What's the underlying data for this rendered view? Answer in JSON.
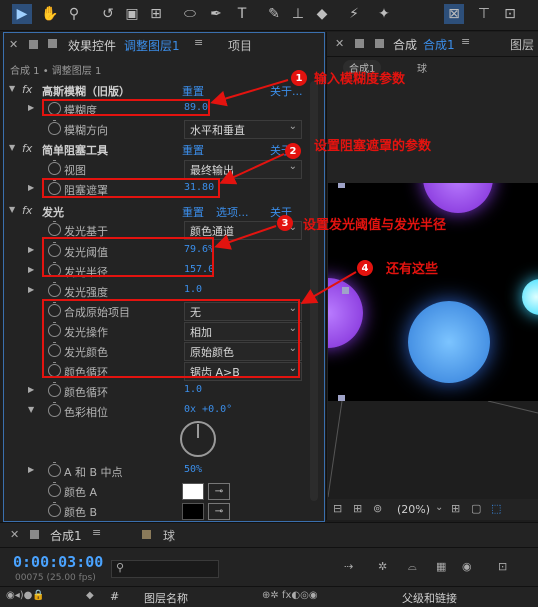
{
  "toolbar": {
    "icons": [
      "selection-tool",
      "hand-tool",
      "zoom-tool",
      "rotate-tool",
      "camera-tool",
      "pan-behind-tool",
      "ellipse-tool",
      "pen-tool",
      "type-tool",
      "brush-tool",
      "clone-stamp-tool",
      "eraser-tool",
      "roto-brush-tool",
      "puppet-tool"
    ]
  },
  "left_panel": {
    "tab_label": "效果控件",
    "tab_layer": "调整图层1",
    "tab_project": "项目",
    "breadcrumb": "合成 1 • 调整图层 1",
    "effects": [
      {
        "name": "高斯模糊（旧版）",
        "reset": "重置",
        "about": "关于..."
      },
      {
        "name": "简单阻塞工具",
        "reset": "重置",
        "about": "关于"
      },
      {
        "name": "发光",
        "reset": "重置",
        "options": "选项...",
        "about": "关于"
      }
    ],
    "params": {
      "blurriness": {
        "label": "模糊度",
        "value": "89.0"
      },
      "blur_dimensions": {
        "label": "模糊方向",
        "value": "水平和垂直"
      },
      "view": {
        "label": "视图",
        "value": "最终输出"
      },
      "choke_matte": {
        "label": "阻塞遮罩",
        "value": "31.80"
      },
      "glow_based_on": {
        "label": "发光基于",
        "value": "颜色通道"
      },
      "glow_threshold": {
        "label": "发光阈值",
        "value": "79.6%"
      },
      "glow_radius": {
        "label": "发光半径",
        "value": "157.0"
      },
      "glow_intensity": {
        "label": "发光强度",
        "value": "1.0"
      },
      "composite_original": {
        "label": "合成原始项目",
        "value": "无"
      },
      "glow_operation": {
        "label": "发光操作",
        "value": "相加"
      },
      "glow_colors": {
        "label": "发光颜色",
        "value": "原始颜色"
      },
      "color_looping": {
        "label": "颜色循环",
        "value": "锯齿 A>B"
      },
      "color_loops": {
        "label": "颜色循环",
        "value": "1.0"
      },
      "color_phase": {
        "label": "色彩相位",
        "value": "0x +0.0°"
      },
      "ab_midpoint": {
        "label": "A 和 B 中点",
        "value": "50%"
      },
      "color_a": {
        "label": "颜色 A"
      },
      "color_b": {
        "label": "颜色 B"
      }
    }
  },
  "annotations": [
    {
      "num": "1",
      "text": "输入模糊度参数"
    },
    {
      "num": "2",
      "text": "设置阻塞遮罩的参数"
    },
    {
      "num": "3",
      "text": "设置发光阈值与发光半径"
    },
    {
      "num": "4",
      "text": "还有这些"
    }
  ],
  "right_panel": {
    "tab_prefix": "合成",
    "tab_comp": "合成1",
    "tab_layer": "图层",
    "sub_tab": "合成1",
    "sub_tab2": "球",
    "zoom": "(20%)"
  },
  "timeline": {
    "tab_comp": "合成1",
    "tab_ball": "球",
    "timecode": "0:00:03:00",
    "frames": "00075 (25.00 fps)",
    "search_placeholder": "",
    "col_hash": "#",
    "col_layer_name": "图层名称",
    "col_parent": "父级和链接"
  },
  "colors": {
    "accent": "#3b8eea",
    "annotation": "#e3130f",
    "ball_purple": "#a05ee8",
    "ball_blue": "#4ea8f0",
    "ball_cyan": "#6fe9ff"
  }
}
